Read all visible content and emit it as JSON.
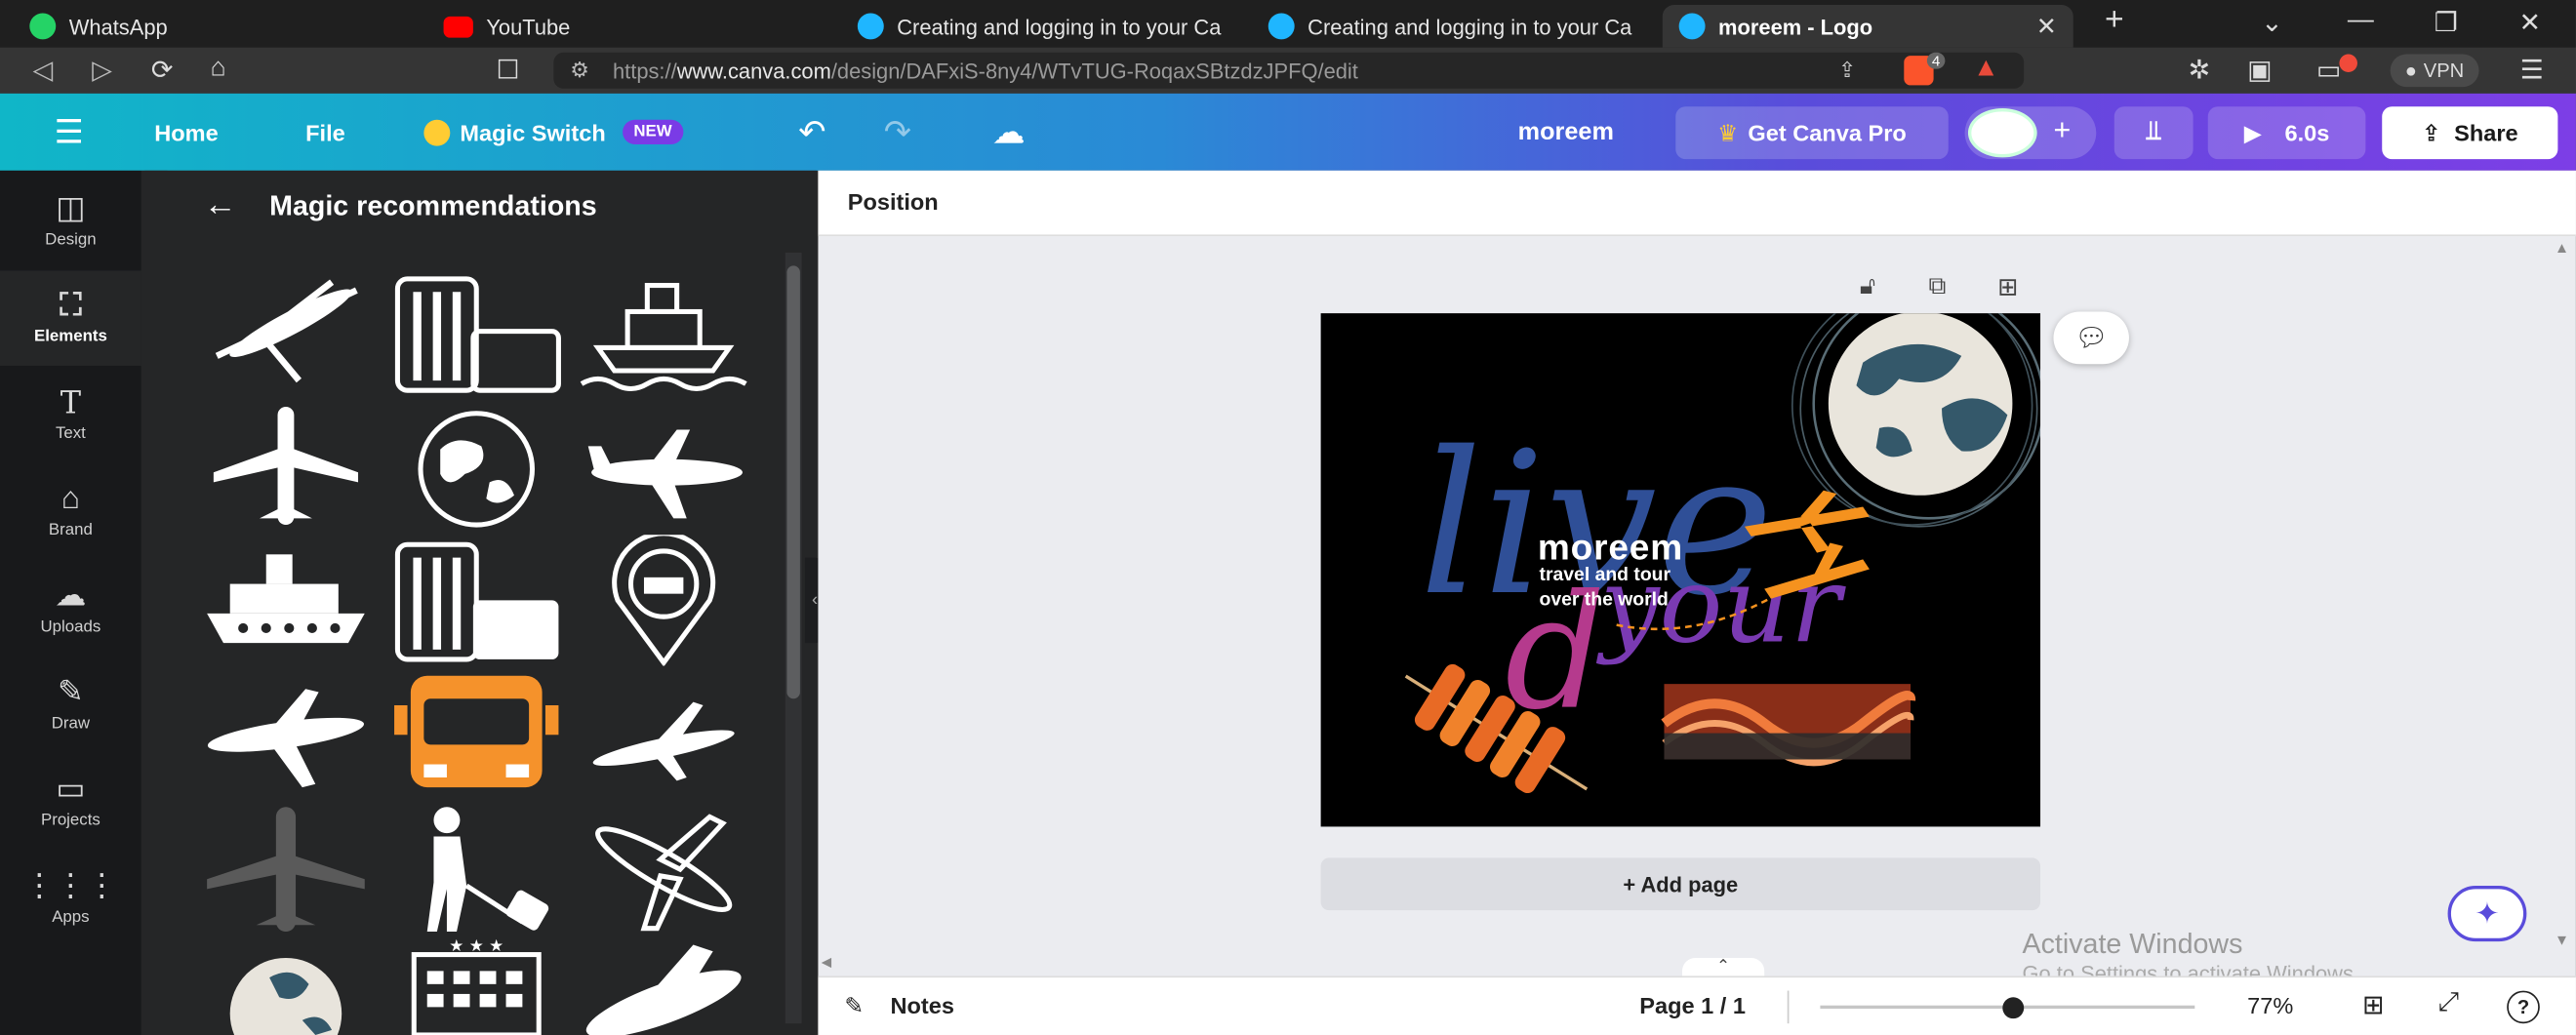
{
  "browser": {
    "tabs": [
      {
        "title": "WhatsApp",
        "color": "#25d366"
      },
      {
        "title": "YouTube",
        "color": "#ff0000"
      },
      {
        "title": "Creating and logging in to your Ca",
        "color": "#1fb6ff"
      },
      {
        "title": "Creating and logging in to your Ca",
        "color": "#1fb6ff"
      },
      {
        "title": "moreem - Logo",
        "color": "#1fb6ff"
      }
    ],
    "new_tab": "+",
    "url_prefix": "https://",
    "url_host": "www.canva.com",
    "url_path": "/design/DAFxiS-8ny4/WTvTUG-RoqaxSBtzdzJPFQ/edit",
    "vpn_label": "VPN",
    "brave_badge": "4"
  },
  "topbar": {
    "home": "Home",
    "file": "File",
    "magic_switch": "Magic Switch",
    "new_badge": "NEW",
    "design_name": "moreem",
    "get_pro": "Get Canva Pro",
    "play_time": "6.0s",
    "share": "Share"
  },
  "rail": [
    {
      "label": "Design",
      "icon": "design-icon"
    },
    {
      "label": "Elements",
      "icon": "elements-icon"
    },
    {
      "label": "Text",
      "icon": "text-icon"
    },
    {
      "label": "Brand",
      "icon": "brand-icon"
    },
    {
      "label": "Uploads",
      "icon": "uploads-icon"
    },
    {
      "label": "Draw",
      "icon": "draw-icon"
    },
    {
      "label": "Projects",
      "icon": "projects-icon"
    },
    {
      "label": "Apps",
      "icon": "apps-icon"
    }
  ],
  "panel": {
    "title": "Magic recommendations"
  },
  "workspace": {
    "position_label": "Position",
    "add_page": "+ Add page",
    "notes": "Notes",
    "page_indicator": "Page 1 / 1",
    "zoom": "77%",
    "help": "?"
  },
  "design": {
    "brand_name": "moreem",
    "tagline_1": "travel and tour",
    "tagline_2": "over the world",
    "script_word_1": "live",
    "script_word_2": "your",
    "script_word_3": "d"
  },
  "watermark": {
    "line1": "Activate Windows",
    "line2": "Go to Settings to activate Windows."
  }
}
